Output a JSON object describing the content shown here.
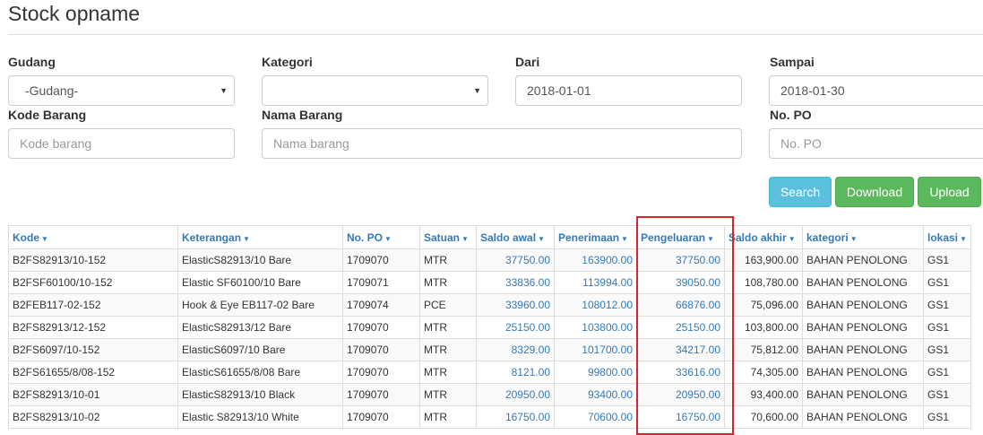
{
  "page": {
    "title": "Stock opname"
  },
  "filters": {
    "gudang": {
      "label": "Gudang",
      "value": "-Gudang-"
    },
    "kategori": {
      "label": "Kategori",
      "value": ""
    },
    "dari": {
      "label": "Dari",
      "value": "2018-01-01"
    },
    "sampai": {
      "label": "Sampai",
      "value": "2018-01-30"
    },
    "kode_barang": {
      "label": "Kode Barang",
      "placeholder": "Kode barang"
    },
    "nama_barang": {
      "label": "Nama Barang",
      "placeholder": "Nama barang"
    },
    "no_po": {
      "label": "No. PO",
      "placeholder": "No. PO"
    }
  },
  "buttons": {
    "search": "Search",
    "download": "Download",
    "upload": "Upload"
  },
  "table": {
    "columns": [
      "Kode",
      "Keterangan",
      "No. PO",
      "Satuan",
      "Saldo awal",
      "Penerimaan",
      "Pengeluaran",
      "Saldo akhir",
      "kategori",
      "lokasi"
    ],
    "rows": [
      [
        "B2FS82913/10-152",
        "ElasticS82913/10 Bare",
        "1709070",
        "MTR",
        "37750.00",
        "163900.00",
        "37750.00",
        "163,900.00",
        "BAHAN PENOLONG",
        "GS1"
      ],
      [
        "B2FSF60100/10-152",
        "Elastic SF60100/10 Bare",
        "1709071",
        "MTR",
        "33836.00",
        "113994.00",
        "39050.00",
        "108,780.00",
        "BAHAN PENOLONG",
        "GS1"
      ],
      [
        "B2FEB117-02-152",
        "Hook & Eye EB117-02 Bare",
        "1709074",
        "PCE",
        "33960.00",
        "108012.00",
        "66876.00",
        "75,096.00",
        "BAHAN PENOLONG",
        "GS1"
      ],
      [
        "B2FS82913/12-152",
        "ElasticS82913/12 Bare",
        "1709070",
        "MTR",
        "25150.00",
        "103800.00",
        "25150.00",
        "103,800.00",
        "BAHAN PENOLONG",
        "GS1"
      ],
      [
        "B2FS6097/10-152",
        "ElasticS6097/10 Bare",
        "1709070",
        "MTR",
        "8329.00",
        "101700.00",
        "34217.00",
        "75,812.00",
        "BAHAN PENOLONG",
        "GS1"
      ],
      [
        "B2FS61655/8/08-152",
        "ElasticS61655/8/08 Bare",
        "1709070",
        "MTR",
        "8121.00",
        "99800.00",
        "33616.00",
        "74,305.00",
        "BAHAN PENOLONG",
        "GS1"
      ],
      [
        "B2FS82913/10-01",
        "ElasticS82913/10 Black",
        "1709070",
        "MTR",
        "20950.00",
        "93400.00",
        "20950.00",
        "93,400.00",
        "BAHAN PENOLONG",
        "GS1"
      ],
      [
        "B2FS82913/10-02",
        "Elastic S82913/10 White",
        "1709070",
        "MTR",
        "16750.00",
        "70600.00",
        "16750.00",
        "70,600.00",
        "BAHAN PENOLONG",
        "GS1"
      ]
    ]
  }
}
